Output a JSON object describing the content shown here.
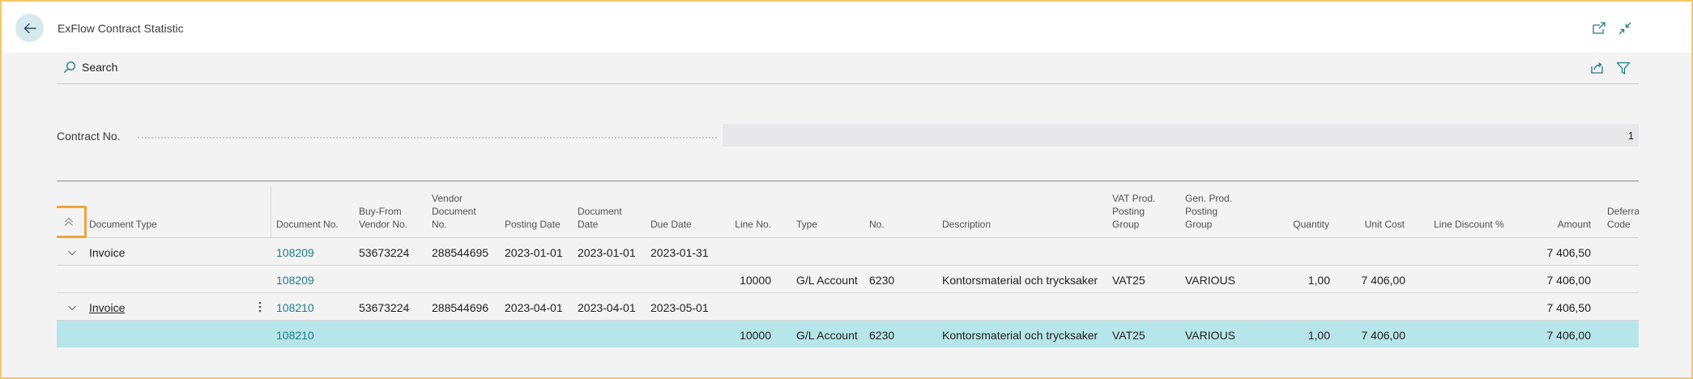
{
  "header": {
    "title": "ExFlow Contract Statistic"
  },
  "toolbar": {
    "search_label": "Search"
  },
  "contract": {
    "label": "Contract No.",
    "value": "1"
  },
  "columns": {
    "document_type": "Document Type",
    "document_no": "Document No.",
    "buy_from_1": "Buy-From",
    "buy_from_2": "Vendor No.",
    "vendor_doc_1": "Vendor",
    "vendor_doc_2": "Document",
    "vendor_doc_3": "No.",
    "posting_date": "Posting Date",
    "doc_date_1": "Document",
    "doc_date_2": "Date",
    "due_date": "Due Date",
    "line_no": "Line No.",
    "type": "Type",
    "no": "No.",
    "description": "Description",
    "vat_1": "VAT Prod.",
    "vat_2": "Posting",
    "vat_3": "Group",
    "gen_1": "Gen. Prod.",
    "gen_2": "Posting",
    "gen_3": "Group",
    "quantity": "Quantity",
    "unit_cost": "Unit Cost",
    "line_discount": "Line Discount %",
    "amount": "Amount",
    "deferral_1": "Deferra",
    "deferral_2": "Code"
  },
  "rows": [
    {
      "document_type": "Invoice",
      "document_no": "108209",
      "buy_from_vendor_no": "53673224",
      "vendor_document_no": "288544695",
      "posting_date": "2023-01-01",
      "document_date": "2023-01-01",
      "due_date": "2023-01-31",
      "amount": "7 406,50"
    },
    {
      "document_no": "108209",
      "line_no": "10000",
      "type": "G/L Account",
      "no": "6230",
      "description": "Kontorsmaterial och trycksaker",
      "vat_prod_posting_group": "VAT25",
      "gen_prod_posting_group": "VARIOUS",
      "quantity": "1,00",
      "unit_cost": "7 406,00",
      "amount": "7 406,00"
    },
    {
      "document_type": "Invoice",
      "document_no": "108210",
      "buy_from_vendor_no": "53673224",
      "vendor_document_no": "288544696",
      "posting_date": "2023-04-01",
      "document_date": "2023-04-01",
      "due_date": "2023-05-01",
      "amount": "7 406,50"
    },
    {
      "document_no": "108210",
      "line_no": "10000",
      "type": "G/L Account",
      "no": "6230",
      "description": "Kontorsmaterial och trycksaker",
      "vat_prod_posting_group": "VAT25",
      "gen_prod_posting_group": "VARIOUS",
      "quantity": "1,00",
      "unit_cost": "7 406,00",
      "amount": "7 406,00"
    }
  ],
  "colors": {
    "accent": "#1d7b8a",
    "selected_row": "#b6e6ea",
    "highlight_border": "#f0a63a",
    "frame_border": "#f2c768"
  }
}
